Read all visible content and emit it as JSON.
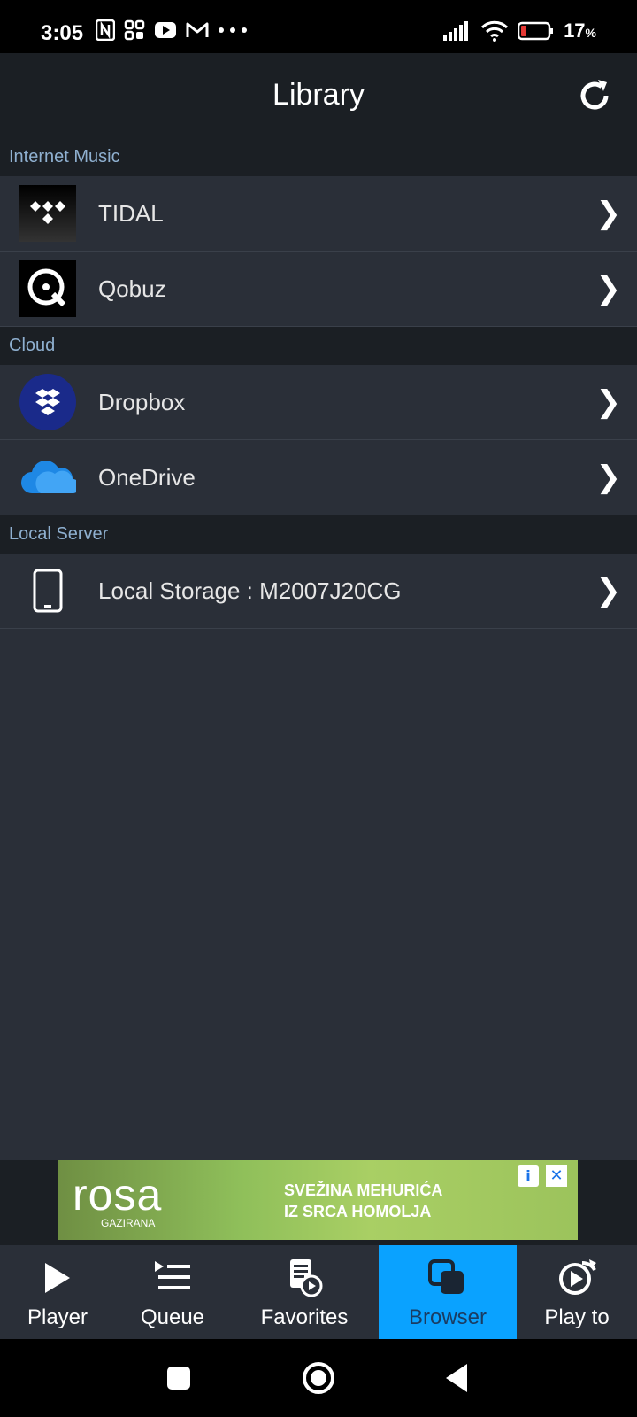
{
  "status_bar": {
    "time": "3:05",
    "battery_percent": "17",
    "battery_suffix": "%",
    "icons": [
      "nfc-icon",
      "scan-icon",
      "youtube-icon",
      "gmail-icon",
      "more-dots-icon",
      "signal-icon",
      "wifi-icon",
      "battery-icon"
    ]
  },
  "header": {
    "title": "Library",
    "refresh_icon": "refresh-icon"
  },
  "sections": [
    {
      "title": "Internet Music",
      "items": [
        {
          "label": "TIDAL",
          "icon": "tidal-icon"
        },
        {
          "label": "Qobuz",
          "icon": "qobuz-icon"
        }
      ]
    },
    {
      "title": "Cloud",
      "items": [
        {
          "label": "Dropbox",
          "icon": "dropbox-icon"
        },
        {
          "label": "OneDrive",
          "icon": "onedrive-icon"
        }
      ]
    },
    {
      "title": "Local Server",
      "items": [
        {
          "label": "Local Storage : M2007J20CG",
          "icon": "phone-icon"
        }
      ]
    }
  ],
  "chevron": "❯",
  "ad": {
    "brand": "rosa",
    "brand_sub": "GAZIRANA",
    "slogan_line1": "SVEŽINA MEHURIĆA",
    "slogan_line2": "IZ SRCA HOMOLJA",
    "adchoices": "i",
    "close": "✕"
  },
  "tabs": [
    {
      "label": "Player",
      "icon": "play-icon"
    },
    {
      "label": "Queue",
      "icon": "queue-icon"
    },
    {
      "label": "Favorites",
      "icon": "favorites-icon"
    },
    {
      "label": "Browser",
      "icon": "browser-icon",
      "active": true
    },
    {
      "label": "Play to",
      "icon": "play-to-icon"
    }
  ],
  "colors": {
    "accent": "#0aa2ff",
    "background": "#2a2f38",
    "section_text": "#8fb0d0"
  }
}
